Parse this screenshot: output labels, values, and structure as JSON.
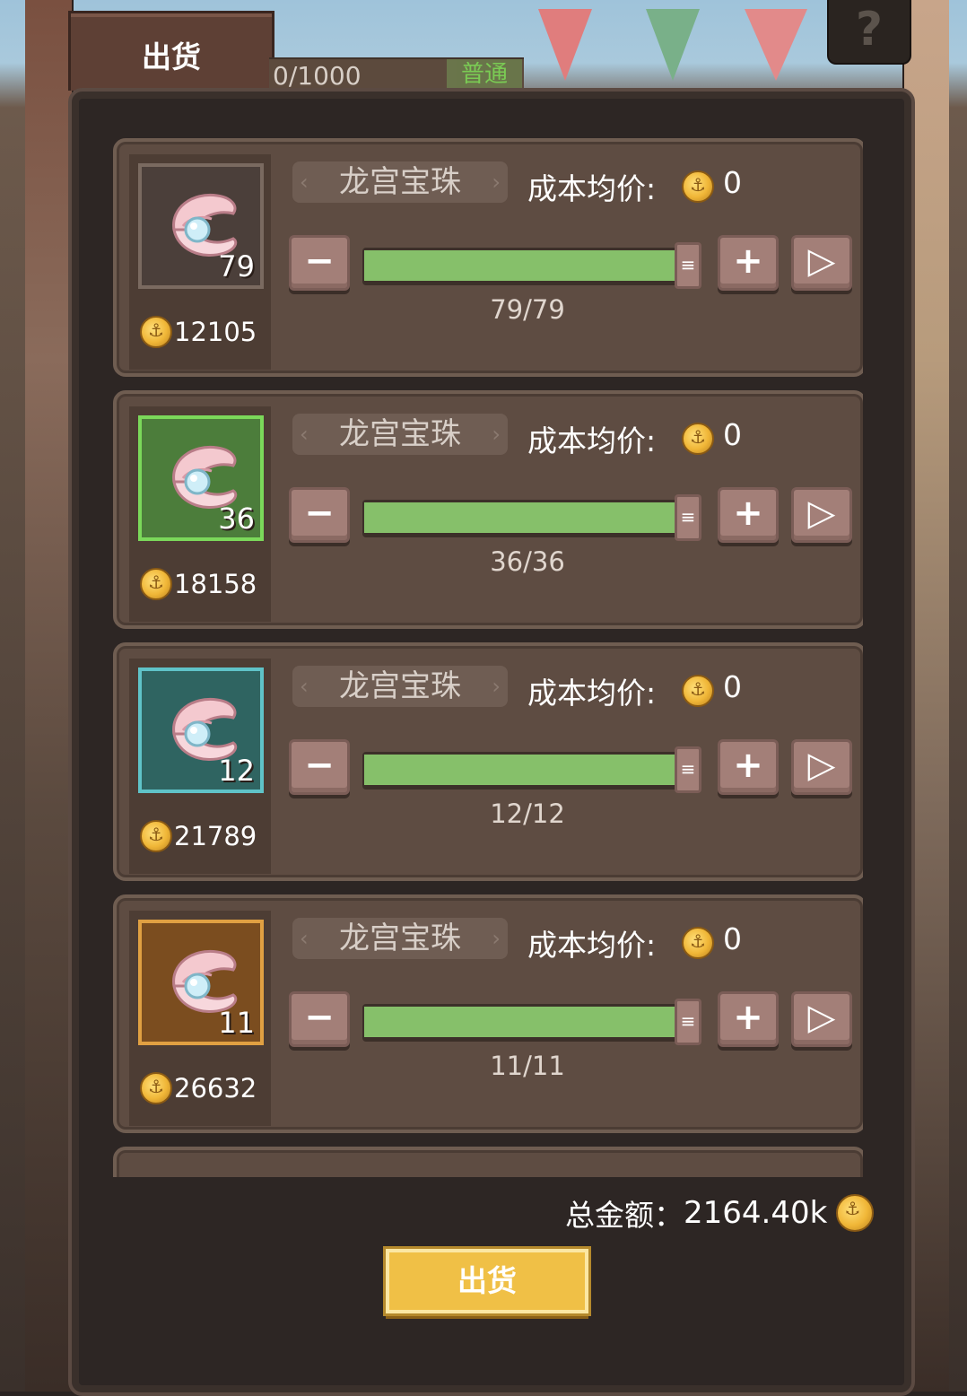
{
  "header": {
    "tab_label": "出货",
    "capacity": "0/1000",
    "rarity_tag": "普通",
    "help_label": "?"
  },
  "items": [
    {
      "name": "龙宫宝珠",
      "cost_label": "成本均价:",
      "cost_value": "0",
      "quantity": "79",
      "price": "12105",
      "count": "79/79",
      "fill_fraction": 1.0,
      "rarity_frame": "gray",
      "icon": "pearl-shell-icon"
    },
    {
      "name": "龙宫宝珠",
      "cost_label": "成本均价:",
      "cost_value": "0",
      "quantity": "36",
      "price": "18158",
      "count": "36/36",
      "fill_fraction": 1.0,
      "rarity_frame": "green",
      "icon": "pearl-shell-icon"
    },
    {
      "name": "龙宫宝珠",
      "cost_label": "成本均价:",
      "cost_value": "0",
      "quantity": "12",
      "price": "21789",
      "count": "12/12",
      "fill_fraction": 1.0,
      "rarity_frame": "teal",
      "icon": "pearl-shell-icon"
    },
    {
      "name": "龙宫宝珠",
      "cost_label": "成本均价:",
      "cost_value": "0",
      "quantity": "11",
      "price": "26632",
      "count": "11/11",
      "fill_fraction": 1.0,
      "rarity_frame": "orange",
      "icon": "pearl-shell-icon"
    }
  ],
  "controls": {
    "minus_label": "−",
    "plus_label": "+",
    "max_label": "▷",
    "handle_label": "≡"
  },
  "footer": {
    "total_label": "总金额：",
    "total_value": "2164.40k",
    "ship_button_label": "出货"
  },
  "colors": {
    "slider_fill": "#86c06a",
    "ship_button": "#f0c046",
    "coin": "#f0b637"
  }
}
